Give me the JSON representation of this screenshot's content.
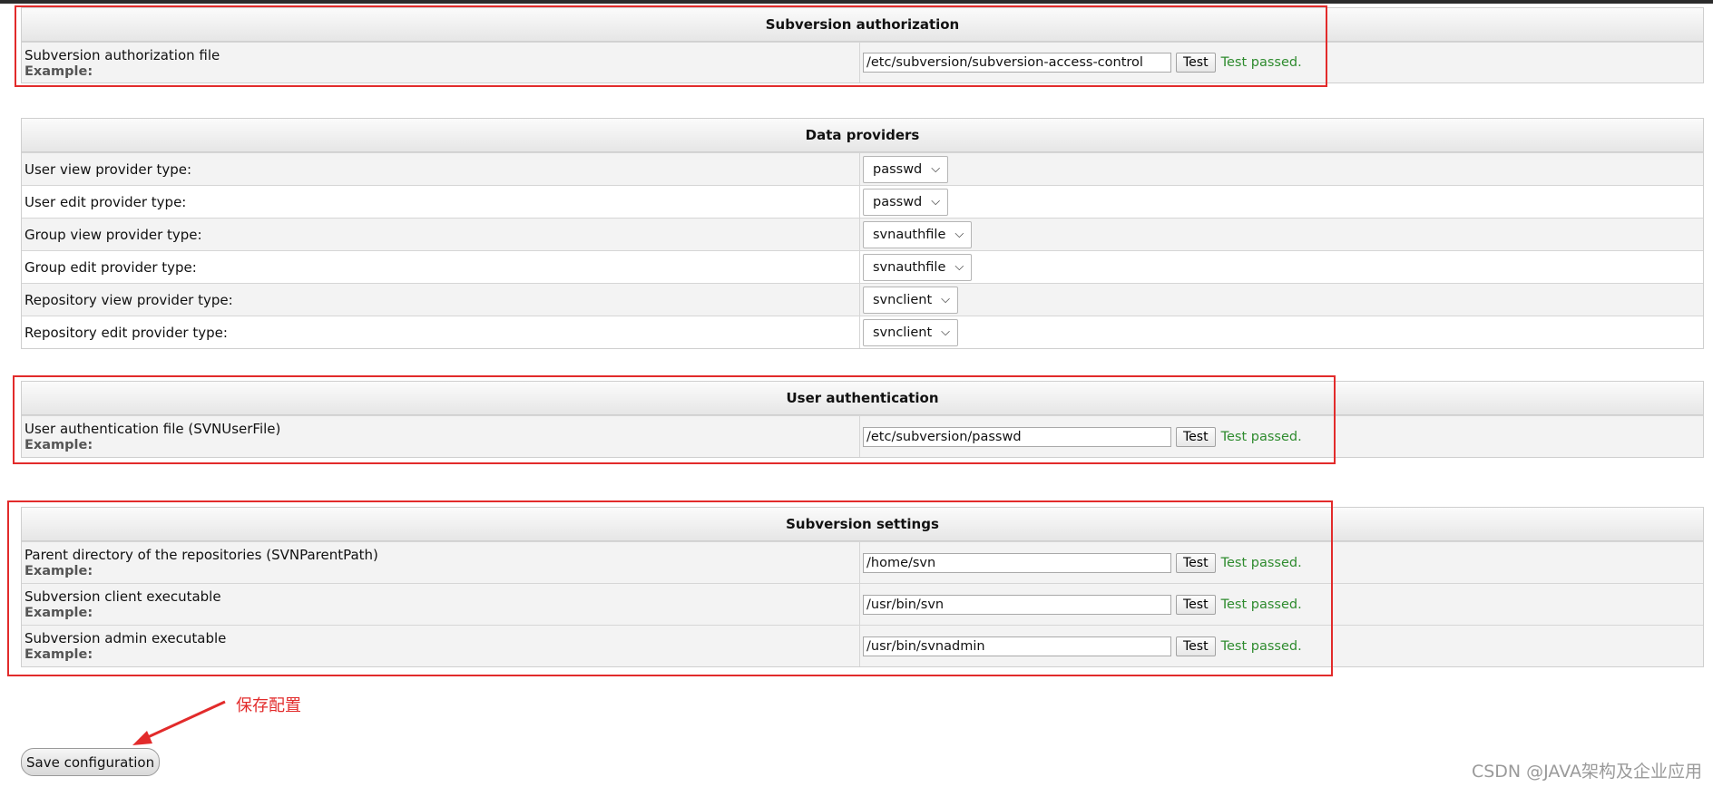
{
  "sections": {
    "auth": {
      "title": "Subversion authorization",
      "row": {
        "label": "Subversion authorization file",
        "example": "Example:",
        "value": "/etc/subversion/subversion-access-control",
        "test": "Test",
        "status": "Test passed."
      }
    },
    "providers": {
      "title": "Data providers",
      "rows": [
        {
          "label": "User view provider type:",
          "value": "passwd"
        },
        {
          "label": "User edit provider type:",
          "value": "passwd"
        },
        {
          "label": "Group view provider type:",
          "value": "svnauthfile"
        },
        {
          "label": "Group edit provider type:",
          "value": "svnauthfile"
        },
        {
          "label": "Repository view provider type:",
          "value": "svnclient"
        },
        {
          "label": "Repository edit provider type:",
          "value": "svnclient"
        }
      ]
    },
    "user_auth": {
      "title": "User authentication",
      "row": {
        "label": "User authentication file (SVNUserFile)",
        "example": "Example:",
        "value": "/etc/subversion/passwd",
        "test": "Test",
        "status": "Test passed."
      }
    },
    "svn_settings": {
      "title": "Subversion settings",
      "rows": [
        {
          "label": "Parent directory of the repositories (SVNParentPath)",
          "example": "Example:",
          "value": "/home/svn",
          "test": "Test",
          "status": "Test passed."
        },
        {
          "label": "Subversion client executable",
          "example": "Example:",
          "value": "/usr/bin/svn",
          "test": "Test",
          "status": "Test passed."
        },
        {
          "label": "Subversion admin executable",
          "example": "Example:",
          "value": "/usr/bin/svnadmin",
          "test": "Test",
          "status": "Test passed."
        }
      ]
    }
  },
  "save_label": "Save configuration",
  "annotation": "保存配置",
  "watermark": "CSDN @JAVA架构及企业应用",
  "icons": {
    "dropdown": "chevron-down-icon",
    "annotation_arrow": "arrow-icon"
  },
  "colors": {
    "annotation_red": "#e22b2b",
    "passed_green": "#2e8b2e"
  }
}
